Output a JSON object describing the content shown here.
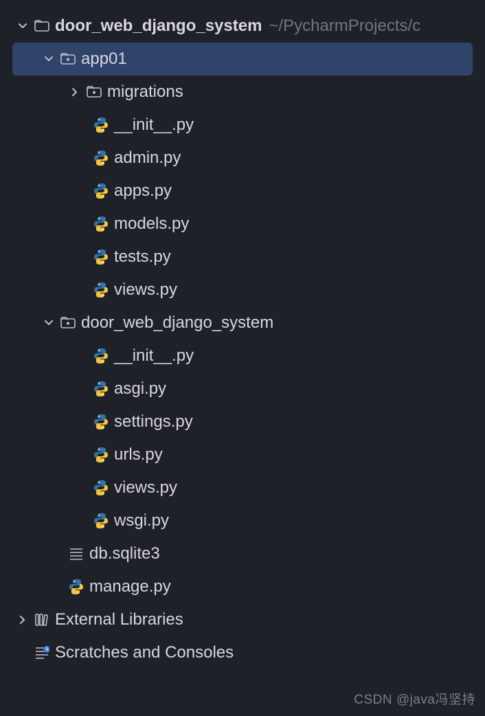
{
  "root": {
    "name": "door_web_django_system",
    "path": "~/PycharmProjects/c"
  },
  "app01": {
    "name": "app01",
    "migrations": "migrations",
    "files": {
      "init": "__init__.py",
      "admin": "admin.py",
      "apps": "apps.py",
      "models": "models.py",
      "tests": "tests.py",
      "views": "views.py"
    }
  },
  "pkg": {
    "name": "door_web_django_system",
    "files": {
      "init": "__init__.py",
      "asgi": "asgi.py",
      "settings": "settings.py",
      "urls": "urls.py",
      "views": "views.py",
      "wsgi": "wsgi.py"
    }
  },
  "rootFiles": {
    "db": "db.sqlite3",
    "manage": "manage.py"
  },
  "external": "External Libraries",
  "scratches": "Scratches and Consoles",
  "watermark": "CSDN @java冯坚持"
}
